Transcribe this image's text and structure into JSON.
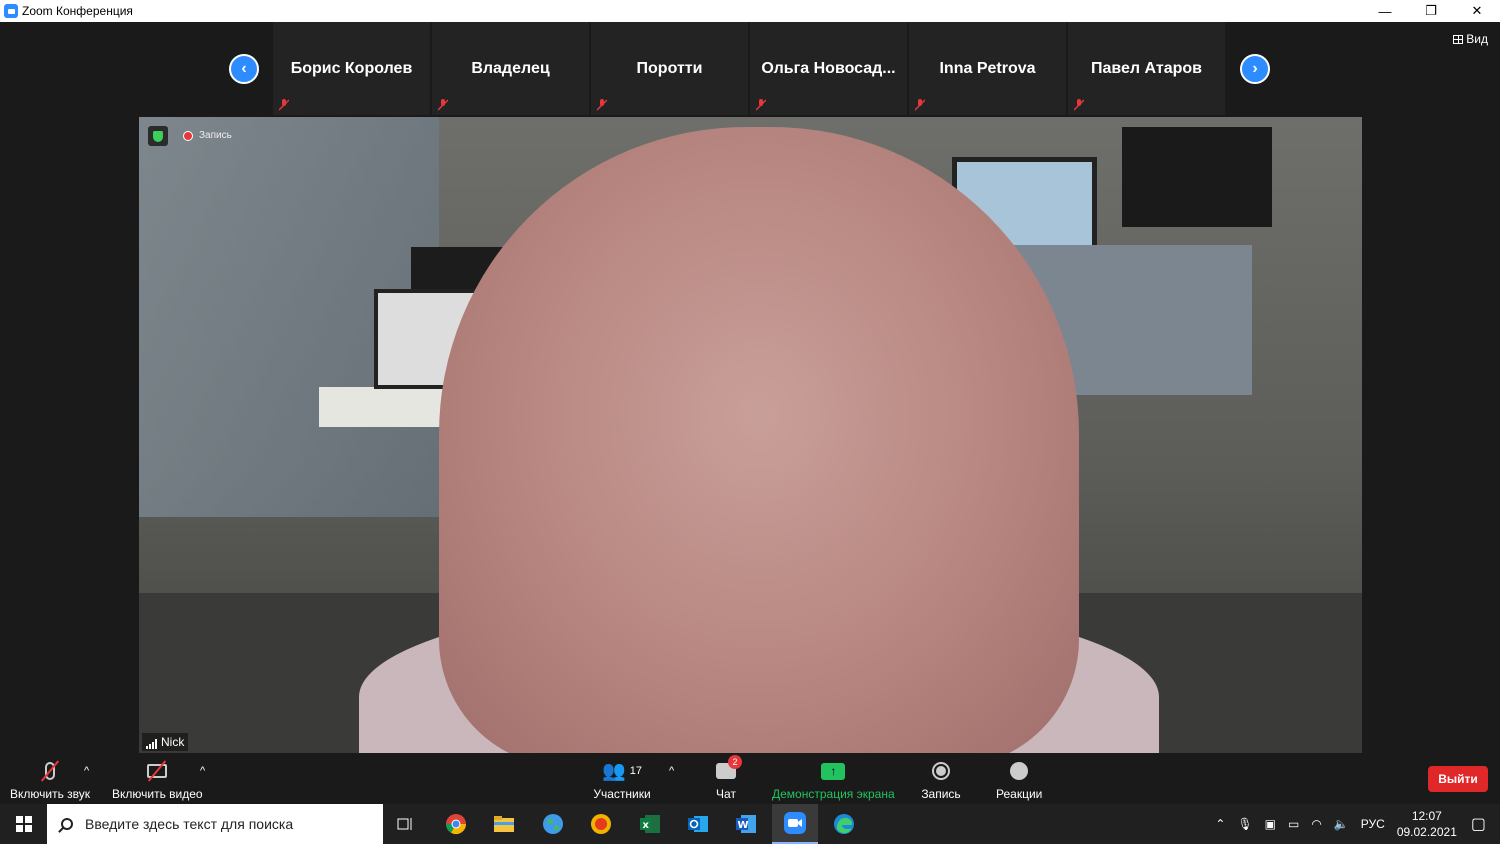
{
  "window": {
    "title": "Zoom Конференция",
    "controls": [
      "—",
      "❐",
      "✕"
    ]
  },
  "view_button": {
    "label": "Вид"
  },
  "participants_strip": {
    "prev_label": "‹",
    "next_label": "›",
    "tiles": [
      {
        "name": "Борис Королев"
      },
      {
        "name": "Владелец"
      },
      {
        "name": "Поротти"
      },
      {
        "name": "Ольга  Новосад..."
      },
      {
        "name": "Inna Petrova"
      },
      {
        "name": "Павел Атаров"
      }
    ]
  },
  "active_speaker": {
    "name": "Nick",
    "recording_label": "Запись"
  },
  "toolbar": {
    "unmute_label": "Включить звук",
    "start_video_label": "Включить видео",
    "participants_label": "Участники",
    "participants_count": "17",
    "chat_label": "Чат",
    "chat_badge": "2",
    "share_label": "Демонстрация экрана",
    "record_label": "Запись",
    "reactions_label": "Реакции",
    "leave_label": "Выйти",
    "caret": "^"
  },
  "taskbar": {
    "search_placeholder": "Введите здесь текст для поиска",
    "language": "РУС",
    "time": "12:07",
    "date": "09.02.2021"
  },
  "colors": {
    "accent": "#2d8cff",
    "leave": "#e02828",
    "share": "#22c35e",
    "muted": "#e6383b"
  }
}
